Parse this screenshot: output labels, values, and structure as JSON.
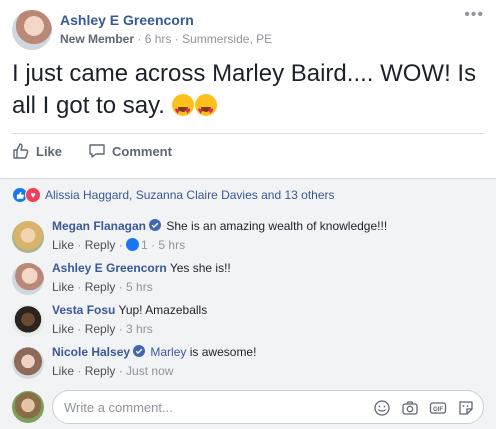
{
  "post": {
    "author": "Ashley E Greencorn",
    "badge": "New Member",
    "time": "6 hrs",
    "location": "Summerside, PE",
    "text": "I just came across Marley Baird.... WOW! Is all I got to say.",
    "emojis": [
      "heart-eyes-emoji",
      "heart-eyes-emoji"
    ],
    "more_icon": "more-dots-icon"
  },
  "actions": {
    "like_label": "Like",
    "comment_label": "Comment"
  },
  "reactions": {
    "summary": "Alissia Haggard, Suzanna Claire Davies and 13 others"
  },
  "comments": [
    {
      "name": "Megan Flanagan",
      "verified": true,
      "text": "She is an amazing wealth of knowledge!!!",
      "like": "Like",
      "reply": "Reply",
      "likes": "1",
      "time": "5 hrs"
    },
    {
      "name": "Ashley E Greencorn",
      "verified": false,
      "text": "Yes she is!!",
      "like": "Like",
      "reply": "Reply",
      "time": "5 hrs"
    },
    {
      "name": "Vesta Fosu",
      "verified": false,
      "text": "Yup! Amazeballs",
      "like": "Like",
      "reply": "Reply",
      "time": "3 hrs"
    },
    {
      "name": "Nicole Halsey",
      "verified": true,
      "mention": "Marley",
      "text": "is awesome!",
      "like": "Like",
      "reply": "Reply",
      "time": "Just now"
    }
  ],
  "write": {
    "placeholder": "Write a comment...",
    "icons": [
      "emoji-icon",
      "camera-icon",
      "gif-icon",
      "sticker-icon"
    ]
  },
  "colors": {
    "link": "#385898",
    "muted": "#90949c",
    "accent": "#1877f2",
    "love": "#f33e58",
    "bg_comments": "#f2f3f5"
  }
}
